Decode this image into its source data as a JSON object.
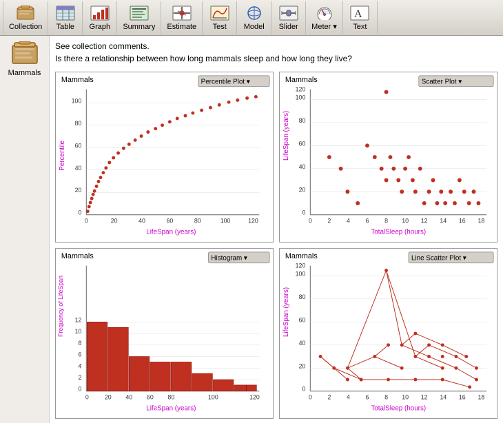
{
  "toolbar": {
    "items": [
      {
        "label": "Collection",
        "icon": "collection-icon"
      },
      {
        "label": "Table",
        "icon": "table-icon"
      },
      {
        "label": "Graph",
        "icon": "graph-icon"
      },
      {
        "label": "Summary",
        "icon": "summary-icon"
      },
      {
        "label": "Estimate",
        "icon": "estimate-icon"
      },
      {
        "label": "Test",
        "icon": "test-icon"
      },
      {
        "label": "Model",
        "icon": "model-icon"
      },
      {
        "label": "Slider",
        "icon": "slider-icon"
      },
      {
        "label": "Meter ▾",
        "icon": "meter-icon"
      },
      {
        "label": "Text",
        "icon": "text-icon"
      }
    ]
  },
  "sidebar": {
    "collection_name": "Mammals"
  },
  "description": {
    "line1": "See collection comments.",
    "line2": "Is there a relationship between how long mammals sleep and how long they live?"
  },
  "plots": [
    {
      "id": "percentile",
      "title": "Mammals",
      "type": "Percentile Plot",
      "x_label": "LifeSpan (years)",
      "y_label": "Percentile"
    },
    {
      "id": "scatter",
      "title": "Mammals",
      "type": "Scatter Plot",
      "x_label": "TotalSleep (hours)",
      "y_label": "LifeSpan (years)"
    },
    {
      "id": "histogram",
      "title": "Mammals",
      "type": "Histogram",
      "x_label": "LifeSpan (years)",
      "y_label": "Frequency of LifeSpan"
    },
    {
      "id": "line-scatter",
      "title": "Mammals",
      "type": "Line Scatter Plot",
      "x_label": "TotalSleep (hours)",
      "y_label": "LifeSpan (years)"
    }
  ]
}
